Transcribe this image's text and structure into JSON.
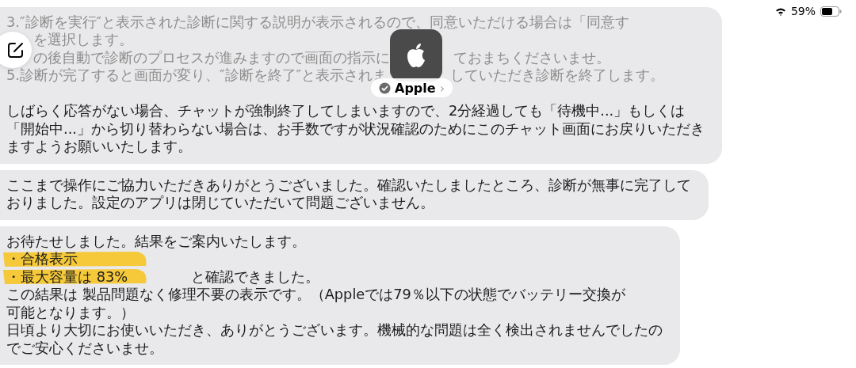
{
  "status_bar": {
    "battery_percent": "59%"
  },
  "header": {
    "name": "Apple",
    "chevron": "›"
  },
  "messages": [
    {
      "lines": [
        {
          "faded": true,
          "segments": [
            "3.″診断を実行″と表示された診断に関する説明が表示されるので、同意いただける場合は「同意す"
          ]
        },
        {
          "faded": true,
          "hidden_start": true,
          "segments": [
            "を選択します。"
          ]
        },
        {
          "faded": true,
          "hidden_start": true,
          "segments": [
            "の後自動で診断のプロセスが進みますので画面の指示に",
            "ておまちくださいませ。"
          ]
        },
        {
          "faded": true,
          "segments": [
            "5.診断が完了すると画面が変り、″診断を終了″と表示されま",
            "していただき診断を終了します。"
          ]
        },
        {
          "faded": false,
          "gap_before": true,
          "segments": [
            "しばらく応答がない場合、チャットが強制終了してしまいますので、2分経過しても「待機中...」もしくは"
          ]
        },
        {
          "faded": false,
          "segments": [
            "「開始中...」から切り替わらない場合は、お手数ですが状況確認のためにこのチャット画面にお戻りいただき"
          ]
        },
        {
          "faded": false,
          "segments": [
            "ますようお願いいたします。"
          ]
        }
      ]
    },
    {
      "lines": [
        {
          "faded": false,
          "segments": [
            "ここまで操作にご協力いただきありがとうございました。確認いたしましたところ、診断が無事に完了して"
          ]
        },
        {
          "faded": false,
          "segments": [
            "おりました。設定のアプリは閉じていただいて問題ございません。"
          ]
        }
      ]
    },
    {
      "lines": [
        {
          "faded": false,
          "segments": [
            "お待たせしました。結果をご案内いたします。"
          ]
        },
        {
          "faded": false,
          "highlighted": true,
          "segments": [
            "・合格表示"
          ]
        },
        {
          "faded": false,
          "highlighted": true,
          "segments": [
            "・最大容量は 83%",
            "と確認できました。"
          ]
        },
        {
          "faded": false,
          "segments": [
            "この結果は 製品問題なく修理不要の表示です。（Appleでは79％以下の状態でバッテリー交換が"
          ]
        },
        {
          "faded": false,
          "segments": [
            "可能となります。）"
          ]
        },
        {
          "faded": false,
          "segments": [
            "日頃より大切にお使いいただき、ありがとうございます。機械的な問題は全く検出されませんでしたの"
          ]
        },
        {
          "faded": false,
          "segments": [
            "でご安心くださいませ。"
          ]
        }
      ]
    }
  ]
}
